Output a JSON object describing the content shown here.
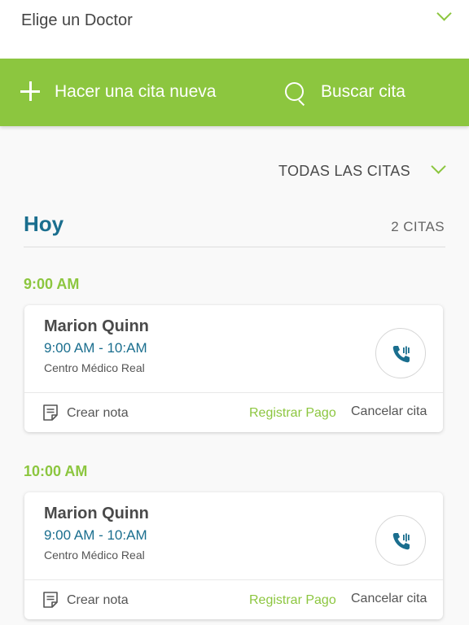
{
  "doctor_select": {
    "label": "Elige un Doctor",
    "icon": "chevron-down-icon"
  },
  "actions": {
    "new_appointment": "Hacer una cita nueva",
    "search": "Buscar cita"
  },
  "filter": {
    "label": "TODAS LAS CITAS",
    "icon": "chevron-down-icon"
  },
  "day": {
    "title": "Hoy",
    "count": "2 CITAS"
  },
  "colors": {
    "accent_green": "#8cc63f",
    "primary_blue": "#1a6e8e"
  },
  "appointments": [
    {
      "time": "9:00 AM",
      "name": "Marion Quinn",
      "range": "9:00 AM - 10:AM",
      "place": "Centro Médico Real",
      "note": "Crear nota",
      "pay": "Registrar Pago",
      "cancel": "Cancelar cita"
    },
    {
      "time": "10:00 AM",
      "name": "Marion Quinn",
      "range": "9:00 AM - 10:AM",
      "place": "Centro Médico Real",
      "note": "Crear nota",
      "pay": "Registrar Pago",
      "cancel": "Cancelar cita"
    }
  ]
}
